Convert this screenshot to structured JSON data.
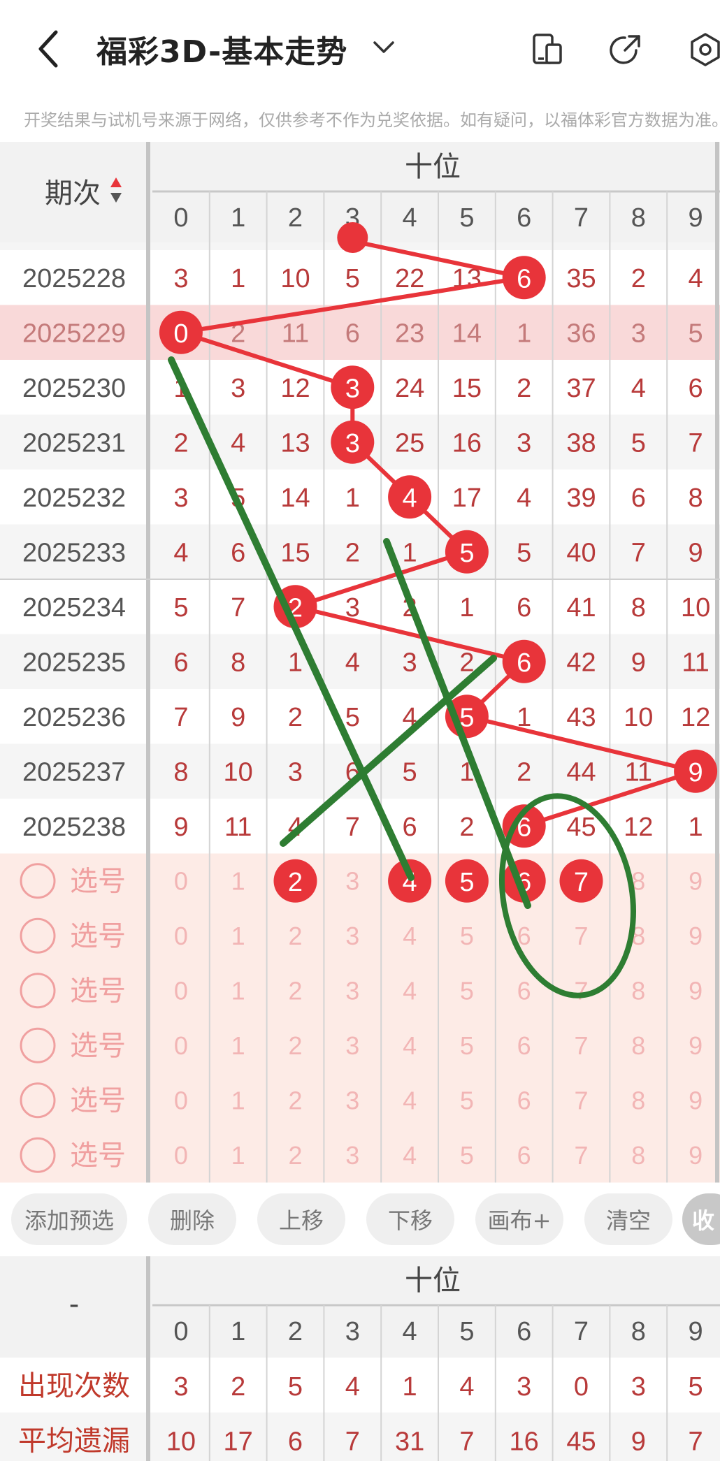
{
  "header": {
    "title": "福彩3D-基本走势",
    "disclaimer": "开奖结果与试机号来源于网络，仅供参考不作为兑奖依据。如有疑问，以福体彩官方数据为准。"
  },
  "table": {
    "period_label": "期次",
    "position_label": "十位",
    "columns": [
      "0",
      "1",
      "2",
      "3",
      "4",
      "5",
      "6",
      "7",
      "8",
      "9"
    ],
    "rows": [
      {
        "period": "2025228",
        "cells": [
          "3",
          "1",
          "10",
          "5",
          "22",
          "13",
          "6",
          "35",
          "2",
          "4"
        ],
        "hit": 6
      },
      {
        "period": "2025229",
        "cells": [
          "0",
          "2",
          "11",
          "6",
          "23",
          "14",
          "1",
          "36",
          "3",
          "5"
        ],
        "hit": 0
      },
      {
        "period": "2025230",
        "cells": [
          "1",
          "3",
          "12",
          "3",
          "24",
          "15",
          "2",
          "37",
          "4",
          "6"
        ],
        "hit": 3
      },
      {
        "period": "2025231",
        "cells": [
          "2",
          "4",
          "13",
          "3",
          "25",
          "16",
          "3",
          "38",
          "5",
          "7"
        ],
        "hit": 3
      },
      {
        "period": "2025232",
        "cells": [
          "3",
          "5",
          "14",
          "1",
          "4",
          "17",
          "4",
          "39",
          "6",
          "8"
        ],
        "hit": 4
      },
      {
        "period": "2025233",
        "cells": [
          "4",
          "6",
          "15",
          "2",
          "1",
          "5",
          "5",
          "40",
          "7",
          "9"
        ],
        "hit": 5
      },
      {
        "period": "2025234",
        "cells": [
          "5",
          "7",
          "2",
          "3",
          "2",
          "1",
          "6",
          "41",
          "8",
          "10"
        ],
        "hit": 2
      },
      {
        "period": "2025235",
        "cells": [
          "6",
          "8",
          "1",
          "4",
          "3",
          "2",
          "6",
          "42",
          "9",
          "11"
        ],
        "hit": 6
      },
      {
        "period": "2025236",
        "cells": [
          "7",
          "9",
          "2",
          "5",
          "4",
          "5",
          "1",
          "43",
          "10",
          "12"
        ],
        "hit": 5
      },
      {
        "period": "2025237",
        "cells": [
          "8",
          "10",
          "3",
          "6",
          "5",
          "1",
          "2",
          "44",
          "11",
          "9"
        ],
        "hit": 9
      },
      {
        "period": "2025238",
        "cells": [
          "9",
          "11",
          "4",
          "7",
          "6",
          "2",
          "6",
          "45",
          "12",
          "1"
        ],
        "hit": 6
      }
    ],
    "select_label": "选号",
    "select_rows": 6,
    "selected_first_row": [
      2,
      4,
      5,
      6,
      7
    ]
  },
  "toolbar": {
    "buttons": [
      "添加预选",
      "删除",
      "上移",
      "下移",
      "画布+",
      "清空",
      "收"
    ]
  },
  "summary": {
    "corner": "-",
    "position_label": "十位",
    "columns": [
      "0",
      "1",
      "2",
      "3",
      "4",
      "5",
      "6",
      "7",
      "8",
      "9"
    ],
    "rows": [
      {
        "label": "出现次数",
        "values": [
          "3",
          "2",
          "5",
          "4",
          "1",
          "4",
          "3",
          "0",
          "3",
          "5"
        ]
      },
      {
        "label": "平均遗漏",
        "values": [
          "10",
          "17",
          "6",
          "7",
          "31",
          "7",
          "16",
          "45",
          "9",
          "7"
        ]
      }
    ]
  },
  "colors": {
    "accent": "#e8343a",
    "text_red": "#b83a3a",
    "drawing_green": "#2e7d32",
    "highlight_row": "#f9d9d9",
    "select_bg": "#fdebe6"
  }
}
